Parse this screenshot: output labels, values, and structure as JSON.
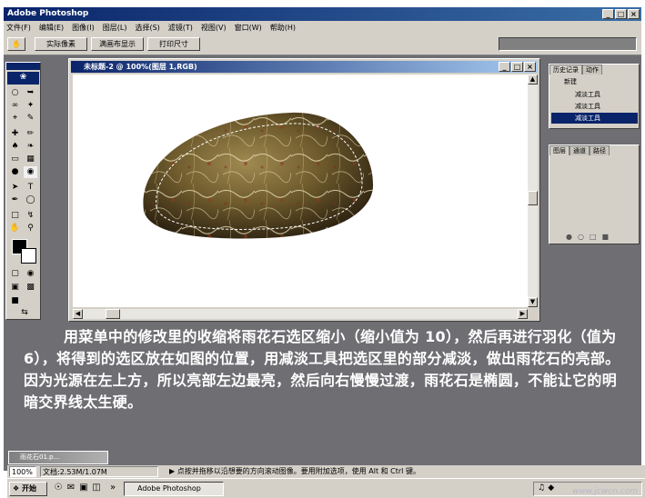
{
  "app": {
    "title": "Adobe Photoshop",
    "window_buttons": [
      "_",
      "×"
    ]
  },
  "menu": [
    "文件(F)",
    "编辑(E)",
    "图像(I)",
    "图层(L)",
    "选择(S)",
    "滤镜(T)",
    "视图(V)",
    "窗口(W)",
    "帮助(H)"
  ],
  "options": {
    "buttons": [
      "实际像素",
      "满画布显示",
      "打印尺寸"
    ]
  },
  "document": {
    "title": "未标题-2 @ 100%(图层 1,RGB)"
  },
  "history_panel": {
    "tabs": [
      "历史记录",
      "动作"
    ],
    "items": [
      "新建",
      "减淡工具",
      "减淡工具",
      "减淡工具"
    ]
  },
  "layers_panel": {
    "tabs": [
      "图层",
      "通道",
      "路径"
    ]
  },
  "caption": "用菜单中的修改里的收缩将雨花石选区缩小（缩小值为 10），然后再进行羽化（值为 6），将得到的选区放在如图的位置，用减淡工具把选区里的部分减淡，做出雨花石的亮部。因为光源在左上方，所以亮部左边最亮，然后向右慢慢过渡，雨花石是椭圆，不能让它的明暗交界线太生硬。",
  "minimized_doc": {
    "title": "雨花石01.p..."
  },
  "status": {
    "zoom": "100%",
    "doc_size": "文档:2.53M/1.07M",
    "tip": "点按并拖移以沿想要的方向滚动图像。要用附加选项，使用 Alt 和 Ctrl 键。"
  },
  "taskbar": {
    "start": "开始",
    "task": "Adobe Photoshop"
  },
  "watermark": "www.jcwcn.com",
  "colors": {
    "workspace": "#6e6e73",
    "panel": "#d4d0c8",
    "titlebar": "#0a246a"
  }
}
